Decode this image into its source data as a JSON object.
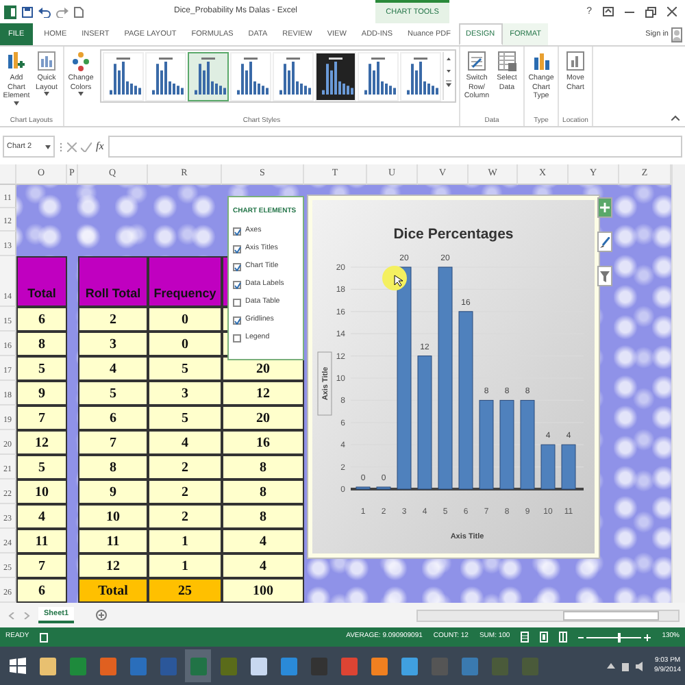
{
  "window": {
    "title": "Dice_Probability Ms Dalas - Excel",
    "context_group": "CHART TOOLS",
    "help": "?"
  },
  "ribbon_tabs": [
    {
      "label": "FILE",
      "kind": "file",
      "selected": false
    },
    {
      "label": "HOME",
      "kind": "tab",
      "selected": false
    },
    {
      "label": "INSERT",
      "kind": "tab",
      "selected": false
    },
    {
      "label": "PAGE LAYOUT",
      "kind": "tab",
      "selected": false
    },
    {
      "label": "FORMULAS",
      "kind": "tab",
      "selected": false
    },
    {
      "label": "DATA",
      "kind": "tab",
      "selected": false
    },
    {
      "label": "REVIEW",
      "kind": "tab",
      "selected": false
    },
    {
      "label": "VIEW",
      "kind": "tab",
      "selected": false
    },
    {
      "label": "ADD-INS",
      "kind": "tab",
      "selected": false
    },
    {
      "label": "Nuance PDF",
      "kind": "tab",
      "selected": false
    },
    {
      "label": "DESIGN",
      "kind": "context",
      "selected": true
    },
    {
      "label": "FORMAT",
      "kind": "context",
      "selected": false
    }
  ],
  "sign_in": "Sign in",
  "ribbon_groups": [
    {
      "label": "Chart Layouts",
      "buttons": [
        {
          "label": "Add Chart Element",
          "dropdown": true
        },
        {
          "label": "Quick Layout",
          "dropdown": true
        }
      ]
    },
    {
      "label": "Chart Styles",
      "buttons": [
        {
          "label": "Change Colors",
          "dropdown": true
        }
      ],
      "gallery": [
        {
          "kind": "light",
          "selected": false
        },
        {
          "kind": "light",
          "selected": false
        },
        {
          "kind": "light",
          "selected": true
        },
        {
          "kind": "light",
          "selected": false
        },
        {
          "kind": "light",
          "selected": false
        },
        {
          "kind": "dark",
          "selected": false
        },
        {
          "kind": "light",
          "selected": false
        },
        {
          "kind": "light",
          "selected": false
        }
      ]
    },
    {
      "label": "Data",
      "buttons": [
        {
          "label": "Switch Row/ Column",
          "dropdown": false
        },
        {
          "label": "Select Data",
          "dropdown": false
        }
      ]
    },
    {
      "label": "Type",
      "buttons": [
        {
          "label": "Change Chart Type",
          "dropdown": false
        }
      ]
    },
    {
      "label": "Location",
      "buttons": [
        {
          "label": "Move Chart",
          "dropdown": false
        }
      ]
    }
  ],
  "formula_bar": {
    "name_box": "Chart 2",
    "function_label": "fx"
  },
  "sheet": {
    "columns": [
      "O",
      "P",
      "Q",
      "R",
      "S",
      "T",
      "U",
      "V",
      "W",
      "X",
      "Y",
      "Z"
    ],
    "row_numbers": [
      "11",
      "12",
      "13",
      "14",
      "15",
      "16",
      "17",
      "18",
      "19",
      "20",
      "21",
      "22",
      "23",
      "24",
      "25",
      "26"
    ],
    "total_column": {
      "header": "Total",
      "values": [
        "6",
        "8",
        "5",
        "9",
        "7",
        "12",
        "5",
        "10",
        "4",
        "11",
        "7",
        "6"
      ]
    },
    "roll_table": {
      "columns": [
        "Roll Total",
        "Frequency"
      ],
      "rows": [
        {
          "roll_total": "2",
          "frequency": "0"
        },
        {
          "roll_total": "3",
          "frequency": "0"
        },
        {
          "roll_total": "4",
          "frequency": "5",
          "column_3": "20"
        },
        {
          "roll_total": "5",
          "frequency": "3",
          "column_3": "12"
        },
        {
          "roll_total": "6",
          "frequency": "5",
          "column_3": "20"
        },
        {
          "roll_total": "7",
          "frequency": "4",
          "column_3": "16"
        },
        {
          "roll_total": "8",
          "frequency": "2",
          "column_3": "8"
        },
        {
          "roll_total": "9",
          "frequency": "2",
          "column_3": "8"
        },
        {
          "roll_total": "10",
          "frequency": "2",
          "column_3": "8"
        },
        {
          "roll_total": "11",
          "frequency": "1",
          "column_3": "4"
        },
        {
          "roll_total": "12",
          "frequency": "1",
          "column_3": "4"
        }
      ],
      "total_row": {
        "label": "Total",
        "frequency": "25",
        "column_3": "100"
      }
    }
  },
  "chart_elements": {
    "title": "CHART ELEMENTS",
    "items": [
      {
        "label": "Axes",
        "checked": true
      },
      {
        "label": "Axis Titles",
        "checked": true
      },
      {
        "label": "Chart Title",
        "checked": true
      },
      {
        "label": "Data Labels",
        "checked": true
      },
      {
        "label": "Data Table",
        "checked": false
      },
      {
        "label": "Gridlines",
        "checked": true
      },
      {
        "label": "Legend",
        "checked": false
      }
    ]
  },
  "chart": {
    "chart_data": {
      "type": "bar",
      "title": "Dice Percentages",
      "xlabel": "Axis Title",
      "ylabel": "Axis Title",
      "categories": [
        "1",
        "2",
        "3",
        "4",
        "5",
        "6",
        "7",
        "8",
        "9",
        "10",
        "11"
      ],
      "values": [
        0,
        0,
        20,
        12,
        20,
        16,
        8,
        8,
        8,
        4,
        4
      ],
      "ylim": [
        0,
        20
      ],
      "yticks": [
        0,
        2,
        4,
        6,
        8,
        10,
        12,
        14,
        16,
        18,
        20
      ],
      "grid": true,
      "data_labels": true
    }
  },
  "sheet_tabs": [
    {
      "label": "Sheet1",
      "selected": true
    }
  ],
  "status_bar": {
    "mode": "READY",
    "stats": [
      "AVERAGE: 9.090909091",
      "COUNT: 12",
      "SUM: 100"
    ],
    "zoom": {
      "level": 0.6,
      "label": "130%"
    }
  },
  "taskbar": {
    "apps": [
      {
        "color": "#e8c070",
        "selected": false
      },
      {
        "color": "#1e8a3c",
        "selected": false
      },
      {
        "color": "#e06020",
        "selected": false
      },
      {
        "color": "#2a6ebb",
        "selected": false
      },
      {
        "color": "#2b579a",
        "selected": false
      },
      {
        "color": "#217346",
        "selected": true
      },
      {
        "color": "#5a6b1a",
        "selected": false
      },
      {
        "color": "#c8d8f0",
        "selected": false
      },
      {
        "color": "#2a8ad8",
        "selected": false
      },
      {
        "color": "#333333",
        "selected": false
      },
      {
        "color": "#dd4433",
        "selected": false
      },
      {
        "color": "#f08020",
        "selected": false
      },
      {
        "color": "#40a0e0",
        "selected": false
      },
      {
        "color": "#555555",
        "selected": false
      },
      {
        "color": "#3a7ab0",
        "selected": false
      },
      {
        "color": "#4a5a3a",
        "selected": false
      },
      {
        "color": "#4a5a3a",
        "selected": false
      }
    ],
    "time": "9:03 PM",
    "date": "9/9/2014"
  }
}
